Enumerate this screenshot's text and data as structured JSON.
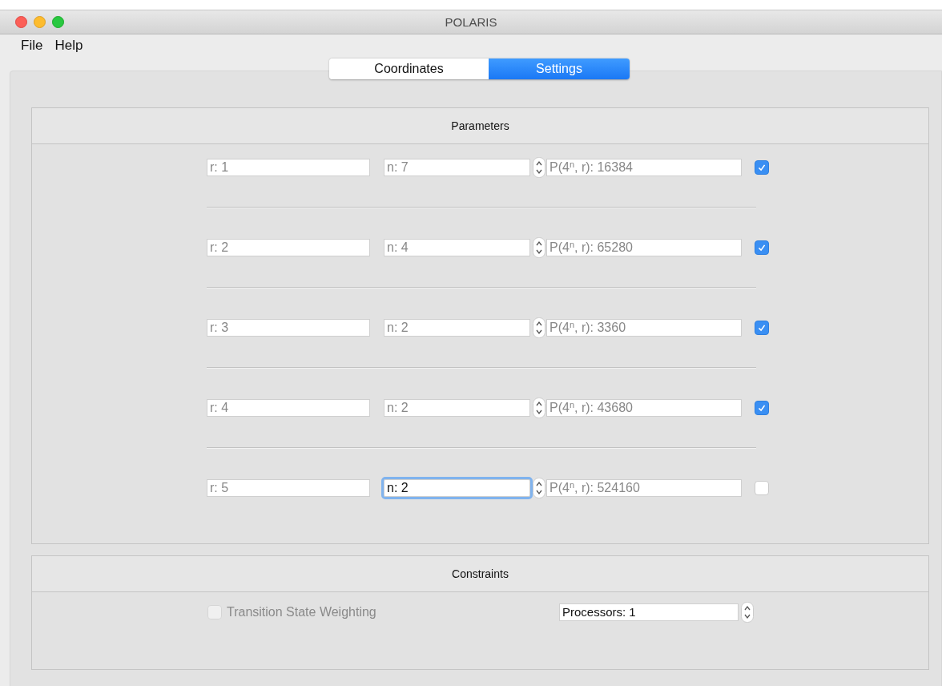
{
  "window": {
    "title": "POLARIS"
  },
  "menu": [
    "File",
    "Help"
  ],
  "tabs": [
    {
      "label": "Coordinates",
      "selected": false
    },
    {
      "label": "Settings",
      "selected": true
    }
  ],
  "parameters": {
    "title": "Parameters",
    "rows": [
      {
        "r": "r: 1",
        "n": "n: 7",
        "n_focused": false,
        "p": "P(4$^{n}$, r): 16384",
        "checked": true
      },
      {
        "r": "r: 2",
        "n": "n: 4",
        "n_focused": false,
        "p": "P(4$^{n}$, r): 65280",
        "checked": true
      },
      {
        "r": "r: 3",
        "n": "n: 2",
        "n_focused": false,
        "p": "P(4$^{n}$, r): 3360",
        "checked": true
      },
      {
        "r": "r: 4",
        "n": "n: 2",
        "n_focused": false,
        "p": "P(4$^{n}$, r): 43680",
        "checked": true
      },
      {
        "r": "r: 5",
        "n": "n: 2",
        "n_focused": true,
        "p": "P(4$^{n}$, r): 524160",
        "checked": false
      }
    ]
  },
  "constraints": {
    "title": "Constraints",
    "weighting": {
      "label": "Transition State Weighting",
      "checked": false,
      "disabled": true
    },
    "processors": {
      "value": "Processors: 1"
    }
  }
}
